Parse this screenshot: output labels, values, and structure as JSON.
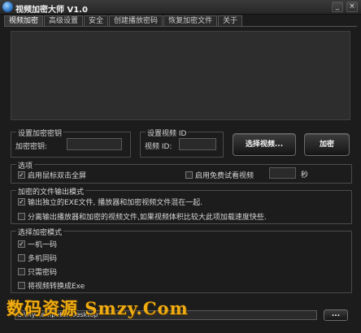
{
  "window": {
    "title": "视频加密大师 V1.0",
    "minimize_label": "_",
    "close_label": "×"
  },
  "tabs": [
    {
      "label": "视频加密",
      "active": true
    },
    {
      "label": "高级设置"
    },
    {
      "label": "安全"
    },
    {
      "label": "创建播放密码"
    },
    {
      "label": "恢复加密文件"
    },
    {
      "label": "关于"
    }
  ],
  "key_group": {
    "legend": "设置加密密钥",
    "field_label": "加密密钥:",
    "value": ""
  },
  "video_id_group": {
    "legend": "设置视频 ID",
    "field_label": "视频 ID:",
    "value": ""
  },
  "buttons": {
    "select_video": "选择视频...",
    "encrypt": "加密",
    "browse": "..."
  },
  "options": {
    "legend": "选项",
    "fullscreen_label": "启用鼠标双击全屏",
    "fullscreen_checked": true,
    "trial_label": "启用免费试看视频",
    "trial_checked": false,
    "trial_seconds": "",
    "seconds_unit": "秒"
  },
  "output_mode": {
    "legend": "加密的文件输出模式",
    "items": [
      {
        "label": "输出独立的EXE文件, 播放器和加密视频文件混在一起.",
        "checked": true
      },
      {
        "label": "分离输出播放器和加密的视频文件,如果视频体积比较大此项加载速度快些.",
        "checked": false
      }
    ]
  },
  "encrypt_mode": {
    "legend": "选择加密模式",
    "items": [
      {
        "label": "一机一码",
        "checked": true
      },
      {
        "label": "多机同码",
        "checked": false
      },
      {
        "label": "只需密码",
        "checked": false
      },
      {
        "label": "将视频转换成Exe",
        "checked": false
      }
    ]
  },
  "output_path": {
    "value": "C:\\My computer\\Desktop"
  },
  "watermark": {
    "text": "数码资源 Smzy.Com"
  },
  "colors": {
    "background": "#1c1c1c",
    "watermark": "#f0ac12"
  }
}
